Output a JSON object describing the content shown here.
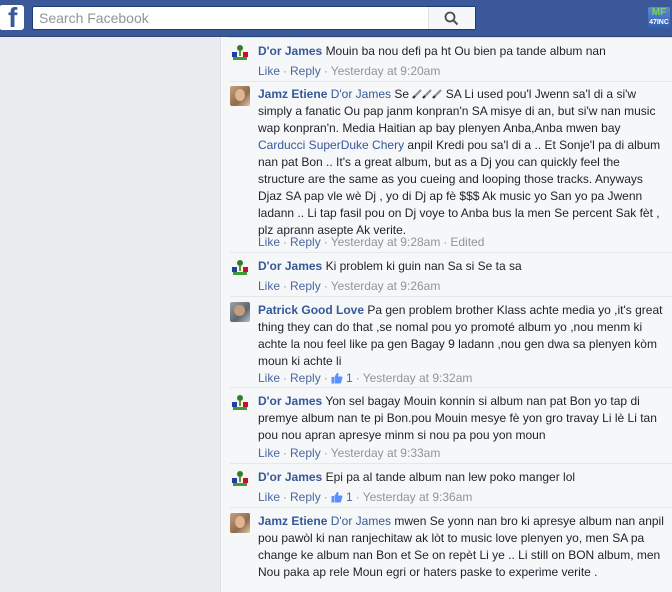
{
  "header": {
    "search_placeholder": "Search Facebook",
    "logo_letter": "f",
    "badge_top": "MF",
    "badge_bottom": "47INC"
  },
  "comments": [
    {
      "author": "D'or James",
      "text": "Mouin ba nou defi pa ht Ou bien pa tande album nan",
      "like": "Like",
      "reply": "Reply",
      "time": "Yesterday at 9:20am"
    },
    {
      "author": "Jamz Etiene",
      "mention": "D'or James",
      "text_a": "Se",
      "text_b": "SA Li used pou'l Jwenn sa'l di a si'w simply a fanatic Ou pap janm konpran'n SA misye di an, but si'w nan music wap konpran'n. Media Haitian ap bay plenyen Anba,Anba mwen bay",
      "mention2": "Carducci SuperDuke Chery",
      "text_c": "anpil Kredi pou sa'l di a .. Et Sonje'l pa di album nan pat Bon .. It's a great album, but as a Dj you can quickly feel the structure are the same as you cueing and looping those tracks. Anyways Djaz SA pap vle wè Dj , yo di Dj ap fè $$$ Ak music yo San yo pa Jwenn ladann .. Li tap fasil pou on Dj voye to Anba bus la men Se percent Sak fèt , plz aprann asepte Ak verite.",
      "like": "Like",
      "reply": "Reply",
      "time": "Yesterday at 9:28am",
      "edited": "Edited"
    },
    {
      "author": "D'or James",
      "text": "Ki problem ki guin nan Sa si Se ta sa",
      "like": "Like",
      "reply": "Reply",
      "time": "Yesterday at 9:26am"
    },
    {
      "author": "Patrick Good Love",
      "text": "Pa gen problem brother Klass achte media yo ,it's great thing they can do that ,se nomal pou yo promoté album yo ,nou menm ki achte la nou feel like pa gen Bagay 9 ladann ,nou gen dwa sa plenyen kòm moun ki achte li",
      "like": "Like",
      "reply": "Reply",
      "likes_count": "1",
      "time": "Yesterday at 9:32am"
    },
    {
      "author": "D'or James",
      "text": "Yon sel bagay Mouin konnin si album nan pat Bon yo tap di premye album nan te pi Bon.pou Mouin mesye fè yon gro travay Li lè Li tan pou nou apran apresye minm si nou pa pou yon moun",
      "like": "Like",
      "reply": "Reply",
      "time": "Yesterday at 9:33am"
    },
    {
      "author": "D'or James",
      "text": "Epi pa al tande album nan lew poko manger lol",
      "like": "Like",
      "reply": "Reply",
      "likes_count": "1",
      "time": "Yesterday at 9:36am"
    },
    {
      "author": "Jamz Etiene",
      "mention": "D'or James",
      "text": "mwen Se yonn nan bro ki apresye album nan anpil pou pawòl ki nan ranjechitaw ak lòt to music love plenyen yo, men SA pa change ke album nan Bon et Se on repèt Li ye .. Li still on BON album, men Nou paka ap rele Moun egri or haters paske to experime verite ."
    }
  ],
  "colors": {
    "topbar": "#3b5998",
    "link": "#365899",
    "meta": "#90949c",
    "background": "#e9ebee"
  }
}
